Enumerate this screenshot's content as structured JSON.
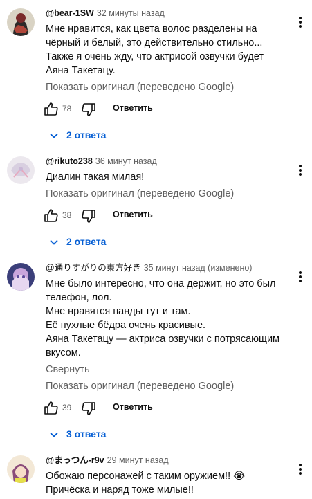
{
  "comments": [
    {
      "author": "@bear-1SW",
      "time": "32 минуты назад",
      "lines": [
        "Мне нравится, как цвета волос разделены на",
        "чёрный и белый, это действительно стильно...",
        "Также я очень жду, что актрисой озвучки будет",
        "Аяна Такетацу."
      ],
      "translation_link": "Показать оригинал (переведено Google)",
      "likes": "78",
      "reply_label": "Ответить",
      "replies_label": "2 ответа"
    },
    {
      "author": "@rikuto238",
      "time": "36 минут назад",
      "lines": [
        "Диалин такая милая!"
      ],
      "translation_link": "Показать оригинал (переведено Google)",
      "likes": "38",
      "reply_label": "Ответить",
      "replies_label": "2 ответа"
    },
    {
      "author": "@通りすがりの東方好き",
      "time": "35 минут назад (изменено)",
      "lines": [
        "Мне было интересно, что она держит, но это был",
        "телефон, лол.",
        "Мне нравятся панды тут и там.",
        "Её пухлые бёдра очень красивые.",
        "Аяна Такетацу — актриса озвучки с потрясающим",
        "вкусом."
      ],
      "collapse_link": "Свернуть",
      "translation_link": "Показать оригинал (переведено Google)",
      "likes": "39",
      "reply_label": "Ответить",
      "replies_label": "3 ответа"
    },
    {
      "author": "@まっつん-r9v",
      "time": "29 минут назад",
      "lines": [
        "Обожаю персонажей с таким оружием!! 😭",
        "Причёска и наряд тоже милые!!"
      ]
    }
  ],
  "icons": {
    "like": "thumbs-up-icon",
    "dislike": "thumbs-down-icon",
    "expand": "chevron-down-icon",
    "menu": "more-vert-icon"
  },
  "colors": {
    "link_blue": "#065fd4",
    "secondary_text": "#606060"
  }
}
